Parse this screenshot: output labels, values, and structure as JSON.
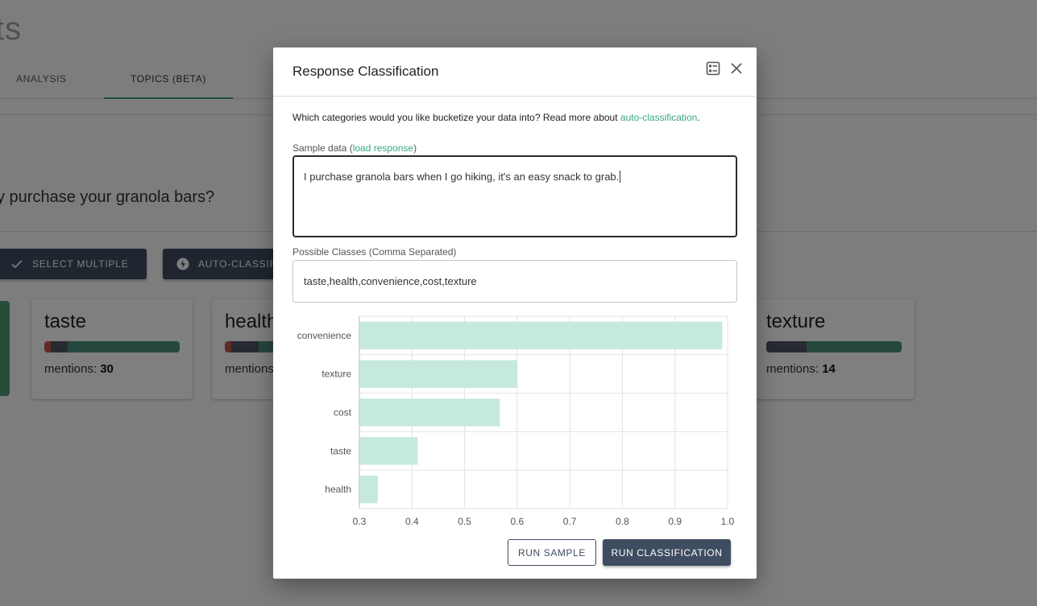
{
  "background": {
    "title_fragment": "ts",
    "tabs": [
      {
        "label": "ANALYSIS",
        "active": false
      },
      {
        "label": "TOPICS (BETA)",
        "active": true
      }
    ],
    "question": "y purchase your granola bars?",
    "buttons": {
      "select_multiple": "SELECT MULTIPLE",
      "auto_classify": "AUTO-CLASSIFY"
    },
    "cards": [
      {
        "name": "taste",
        "mentions_label": "mentions:",
        "mentions": "30"
      },
      {
        "name": "health",
        "mentions_label": "mentions:",
        "mentions": ""
      },
      {
        "name": "texture",
        "mentions_label": "mentions:",
        "mentions": "14"
      }
    ],
    "colors": {
      "accent_green": "#3a9d84",
      "bar_teal": "#4a8f7c",
      "bar_gray": "#4f5560",
      "bar_red": "#c0574f"
    }
  },
  "modal": {
    "title": "Response Classification",
    "header_icons": [
      "list-settings-icon",
      "close-icon"
    ],
    "intro_text": "Which categories would you like bucketize your data into? Read more about ",
    "intro_link": "auto-classification",
    "intro_end": ".",
    "sample_label_prefix": "Sample data (",
    "sample_label_link": "load response",
    "sample_label_suffix": ")",
    "sample_text": "I purchase granola bars when I go hiking, it's an easy snack to grab.",
    "classes_label": "Possible Classes (Comma Separated)",
    "classes_value": "taste,health,convenience,cost,texture",
    "run_sample": "RUN SAMPLE",
    "run_classification": "RUN CLASSIFICATION"
  },
  "chart_data": {
    "type": "bar",
    "orientation": "horizontal",
    "categories": [
      "convenience",
      "texture",
      "cost",
      "taste",
      "health"
    ],
    "values": [
      0.99,
      0.6,
      0.567,
      0.411,
      0.335
    ],
    "xlim": [
      0.3,
      1.0
    ],
    "xticks": [
      "0.3",
      "0.4",
      "0.5",
      "0.6",
      "0.7",
      "0.8",
      "0.9",
      "1.0"
    ],
    "grid": true,
    "bar_color": "#c6e9dd"
  }
}
